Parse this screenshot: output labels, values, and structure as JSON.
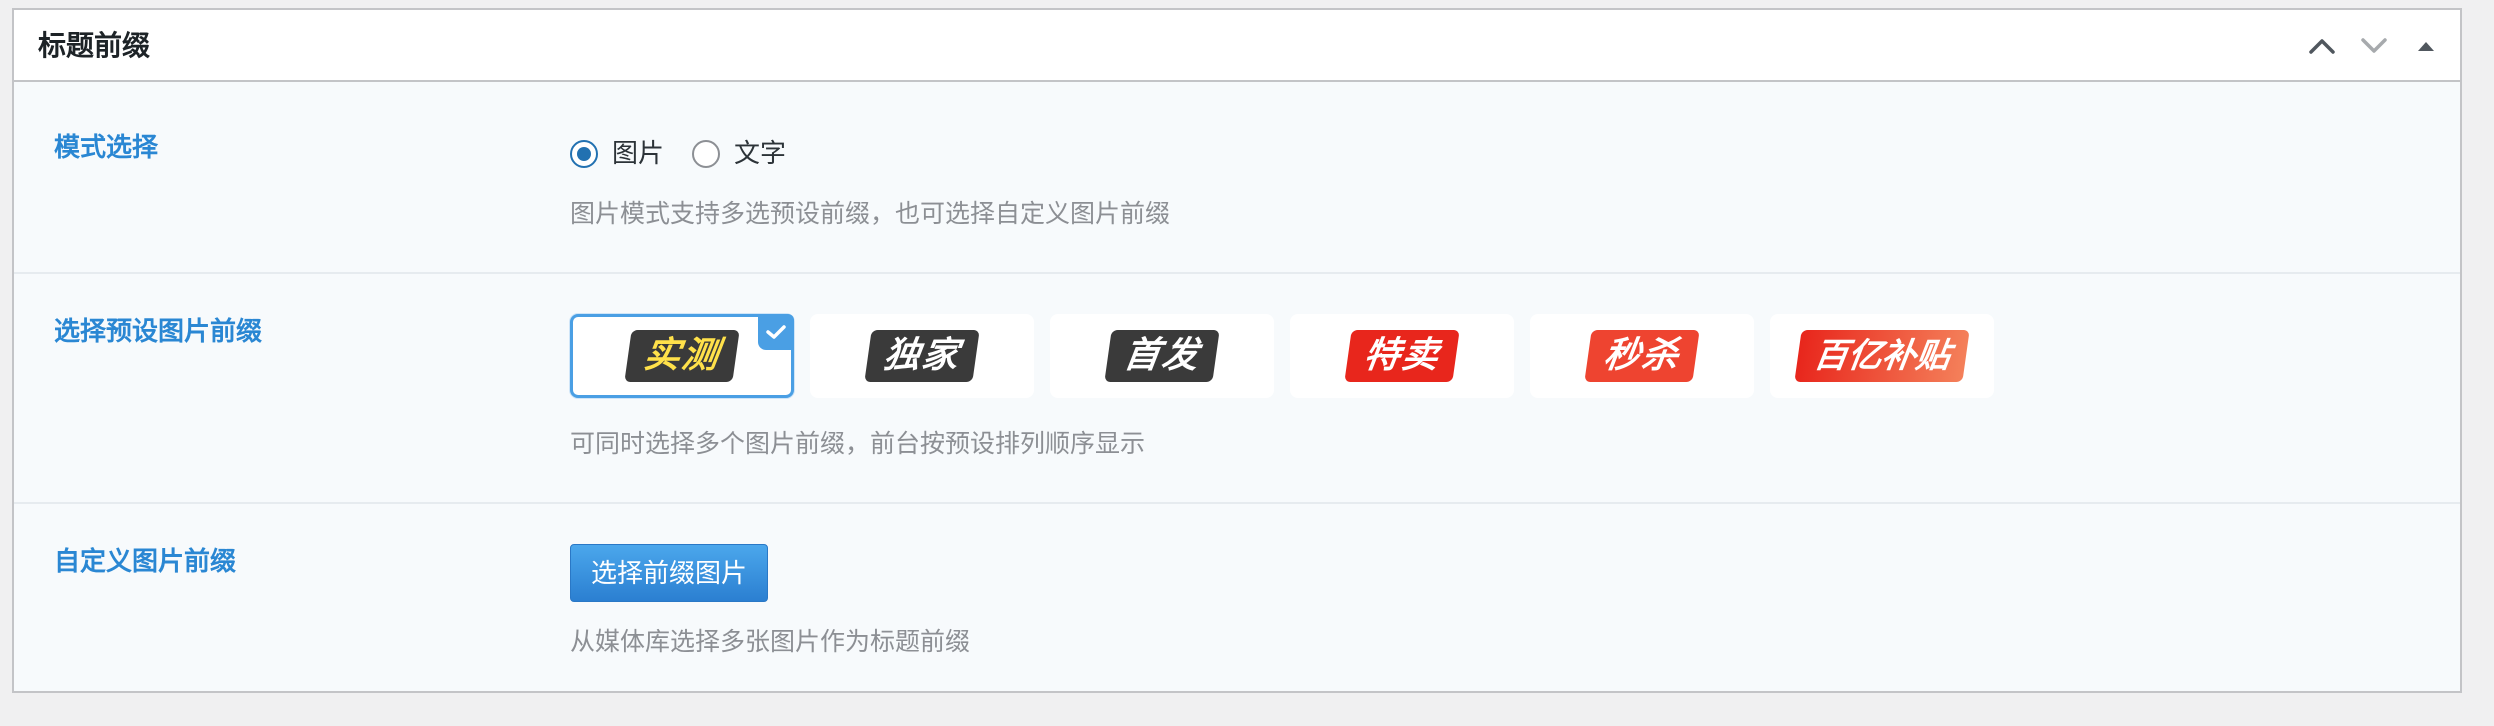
{
  "panel": {
    "title": "标题前缀"
  },
  "mode": {
    "label": "模式选择",
    "options": [
      {
        "label": "图片",
        "checked": true
      },
      {
        "label": "文字",
        "checked": false
      }
    ],
    "description": "图片模式支持多选预设前缀，也可选择自定义图片前缀"
  },
  "presets": {
    "label": "选择预设图片前缀",
    "items": [
      {
        "text": "实测",
        "bg": "#3a3a3a",
        "color": "#ffe14a",
        "selected": true
      },
      {
        "text": "独家",
        "bg": "#3a3a3a",
        "color": "#ffffff",
        "selected": false
      },
      {
        "text": "首发",
        "bg": "#3a3a3a",
        "color": "#ffffff",
        "selected": false
      },
      {
        "text": "特卖",
        "bg": "#e8261c",
        "color": "#ffffff",
        "selected": false
      },
      {
        "text": "秒杀",
        "bg": "#ee4430",
        "color": "#ffffff",
        "selected": false
      },
      {
        "text": "百亿补贴",
        "bg": "#f05a3c",
        "color": "#ffffff",
        "selected": false
      }
    ],
    "description": "可同时选择多个图片前缀，前台按预设排列顺序显示"
  },
  "custom": {
    "label": "自定义图片前缀",
    "button_label": "选择前缀图片",
    "description": "从媒体库选择多张图片作为标题前缀"
  },
  "colors": {
    "accent": "#2a87d3",
    "selected_border": "#4a9fe4"
  },
  "icons": [
    "chevron-up-icon",
    "chevron-down-icon",
    "caret-up-icon",
    "checkmark-icon"
  ]
}
